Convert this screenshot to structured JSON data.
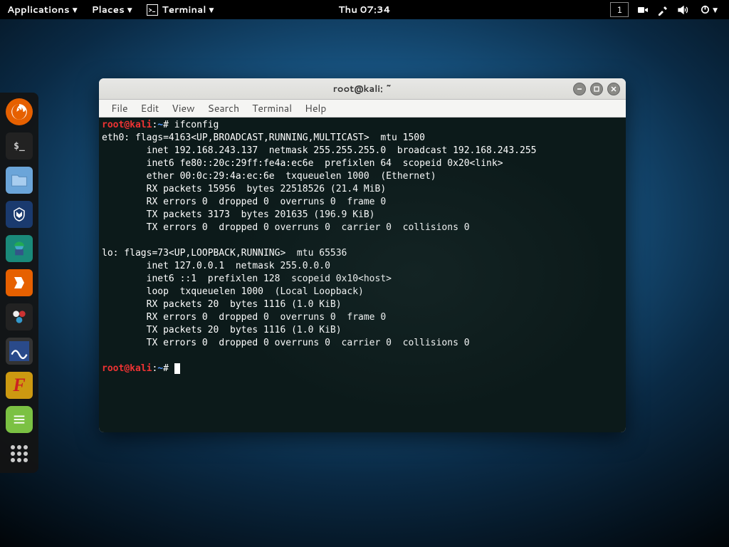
{
  "panel": {
    "applications": "Applications",
    "places": "Places",
    "terminal": "Terminal",
    "clock": "Thu 07:34",
    "workspace": "1"
  },
  "window": {
    "title": "root@kali: ~"
  },
  "menubar": {
    "file": "File",
    "edit": "Edit",
    "view": "View",
    "search": "Search",
    "terminal": "Terminal",
    "help": "Help"
  },
  "prompt": {
    "user": "root",
    "at": "@",
    "host": "kali",
    "colon": ":",
    "path": "~",
    "hash": "#"
  },
  "cmd1": " ifconfig",
  "output": [
    "eth0: flags=4163<UP,BROADCAST,RUNNING,MULTICAST>  mtu 1500",
    "        inet 192.168.243.137  netmask 255.255.255.0  broadcast 192.168.243.255",
    "        inet6 fe80::20c:29ff:fe4a:ec6e  prefixlen 64  scopeid 0x20<link>",
    "        ether 00:0c:29:4a:ec:6e  txqueuelen 1000  (Ethernet)",
    "        RX packets 15956  bytes 22518526 (21.4 MiB)",
    "        RX errors 0  dropped 0  overruns 0  frame 0",
    "        TX packets 3173  bytes 201635 (196.9 KiB)",
    "        TX errors 0  dropped 0 overruns 0  carrier 0  collisions 0",
    "",
    "lo: flags=73<UP,LOOPBACK,RUNNING>  mtu 65536",
    "        inet 127.0.0.1  netmask 255.0.0.0",
    "        inet6 ::1  prefixlen 128  scopeid 0x10<host>",
    "        loop  txqueuelen 1000  (Local Loopback)",
    "        RX packets 20  bytes 1116 (1.0 KiB)",
    "        RX errors 0  dropped 0  overruns 0  frame 0",
    "        TX packets 20  bytes 1116 (1.0 KiB)",
    "        TX errors 0  dropped 0 overruns 0  carrier 0  collisions 0",
    ""
  ]
}
